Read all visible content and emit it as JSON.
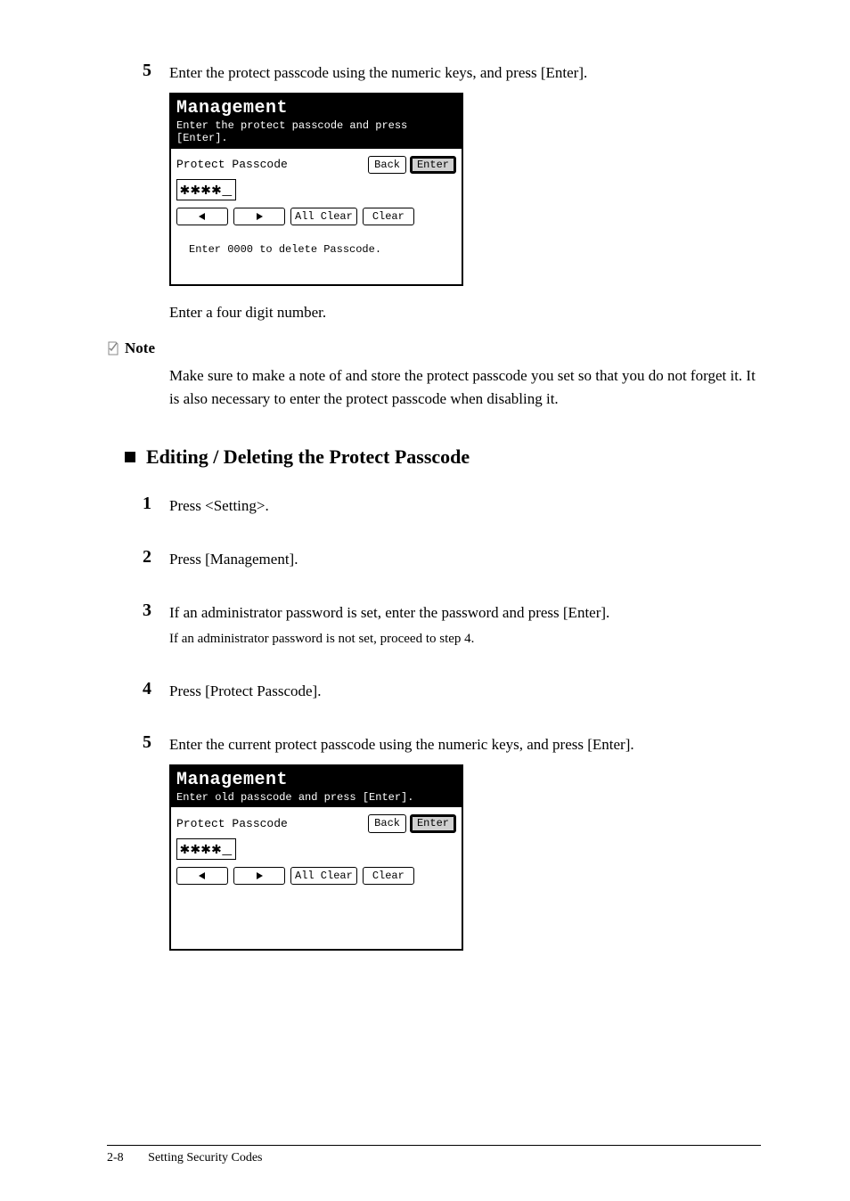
{
  "steps_top": {
    "num5": "5",
    "text5": "Enter the protect passcode using the numeric keys, and press [Enter]."
  },
  "screen1": {
    "title": "Management",
    "subtitle": "Enter the protect passcode and press [Enter].",
    "label": "Protect Passcode",
    "back": "Back",
    "enter": "Enter",
    "value": "✱✱✱✱",
    "allclear": "All Clear",
    "clear": "Clear",
    "hint": "Enter 0000 to delete Passcode."
  },
  "after_screen1": "Enter a four digit number.",
  "note": {
    "label": "Note",
    "text": "Make sure to make a note of and store the protect passcode you set so that you do not forget it. It is also necessary to enter the protect passcode when disabling it."
  },
  "section_heading": "Editing / Deleting the Protect Passcode",
  "steps_bottom": [
    {
      "num": "1",
      "text": "Press <Setting>."
    },
    {
      "num": "2",
      "text": "Press [Management]."
    },
    {
      "num": "3",
      "text": "If an administrator password is set, enter the password and press [Enter].",
      "sub": "If an administrator password is not set, proceed to step 4."
    },
    {
      "num": "4",
      "text": "Press [Protect Passcode]."
    },
    {
      "num": "5",
      "text": "Enter the current protect passcode using the numeric keys, and press [Enter]."
    }
  ],
  "screen2": {
    "title": "Management",
    "subtitle": "Enter old passcode and press [Enter].",
    "label": "Protect Passcode",
    "back": "Back",
    "enter": "Enter",
    "value": "✱✱✱✱",
    "allclear": "All Clear",
    "clear": "Clear"
  },
  "footer": {
    "page": "2-8",
    "title": "Setting Security Codes"
  }
}
